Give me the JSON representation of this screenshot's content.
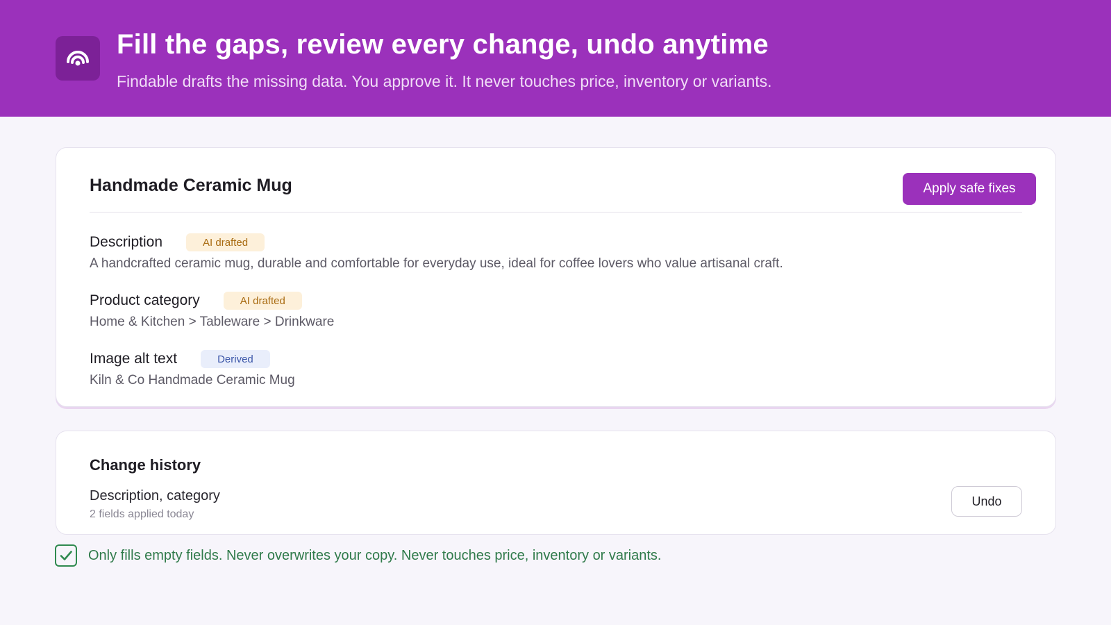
{
  "banner": {
    "logo_icon": "signal-waves-icon",
    "title": "Fill the gaps, review every change, undo anytime",
    "subtitle": "Findable drafts the missing data. You approve it. It never touches price, inventory or variants."
  },
  "product": {
    "title": "Handmade Ceramic Mug",
    "apply_label": "Apply safe fixes",
    "fields": [
      {
        "label": "Description",
        "badge": "AI drafted",
        "value": "A handcrafted ceramic mug, durable and comfortable for everyday use, ideal for coffee lovers who value artisanal craft."
      },
      {
        "label": "Product category",
        "badge": "AI drafted",
        "value": "Home & Kitchen > Tableware > Drinkware"
      },
      {
        "label": "Image alt text",
        "badge": "Derived",
        "value": "Kiln & Co Handmade Ceramic Mug"
      }
    ]
  },
  "history": {
    "title": "Change history",
    "item_name": "Description, category",
    "item_meta": "2 fields applied today",
    "undo_label": "Undo"
  },
  "guarantee": {
    "icon": "checkbox-checked-icon",
    "text": "Only fills empty fields. Never overwrites your copy. Never touches price, inventory or variants."
  },
  "colors": {
    "brand": "#9b31bb",
    "ai_badge_bg": "#fdf0da",
    "derived_badge_bg": "#e9eefb",
    "success": "#2f8a4f"
  }
}
